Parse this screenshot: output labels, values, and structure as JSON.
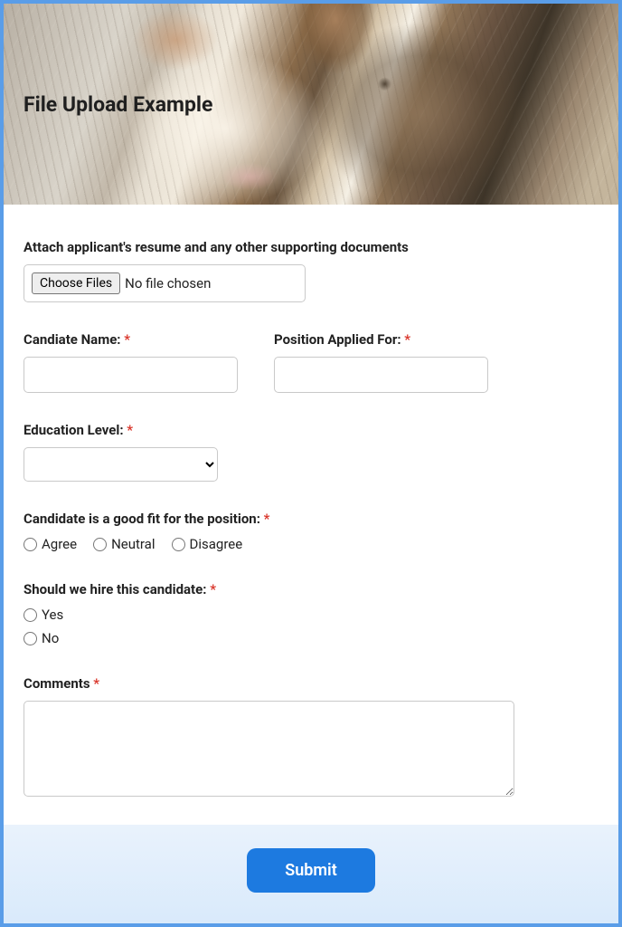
{
  "header": {
    "title": "File Upload Example"
  },
  "upload": {
    "label": "Attach applicant's resume and any other supporting documents",
    "button": "Choose Files",
    "status": "No file chosen"
  },
  "name": {
    "label": "Candiate Name:",
    "value": ""
  },
  "position": {
    "label": "Position Applied For:",
    "value": ""
  },
  "education": {
    "label": "Education Level:",
    "value": ""
  },
  "fit": {
    "label": "Candidate is a good fit for the position:",
    "options": {
      "agree": "Agree",
      "neutral": "Neutral",
      "disagree": "Disagree"
    }
  },
  "hire": {
    "label": "Should we hire this candidate:",
    "options": {
      "yes": "Yes",
      "no": "No"
    }
  },
  "comments": {
    "label": "Comments",
    "value": ""
  },
  "submit": {
    "label": "Submit"
  },
  "asterisk": "*"
}
